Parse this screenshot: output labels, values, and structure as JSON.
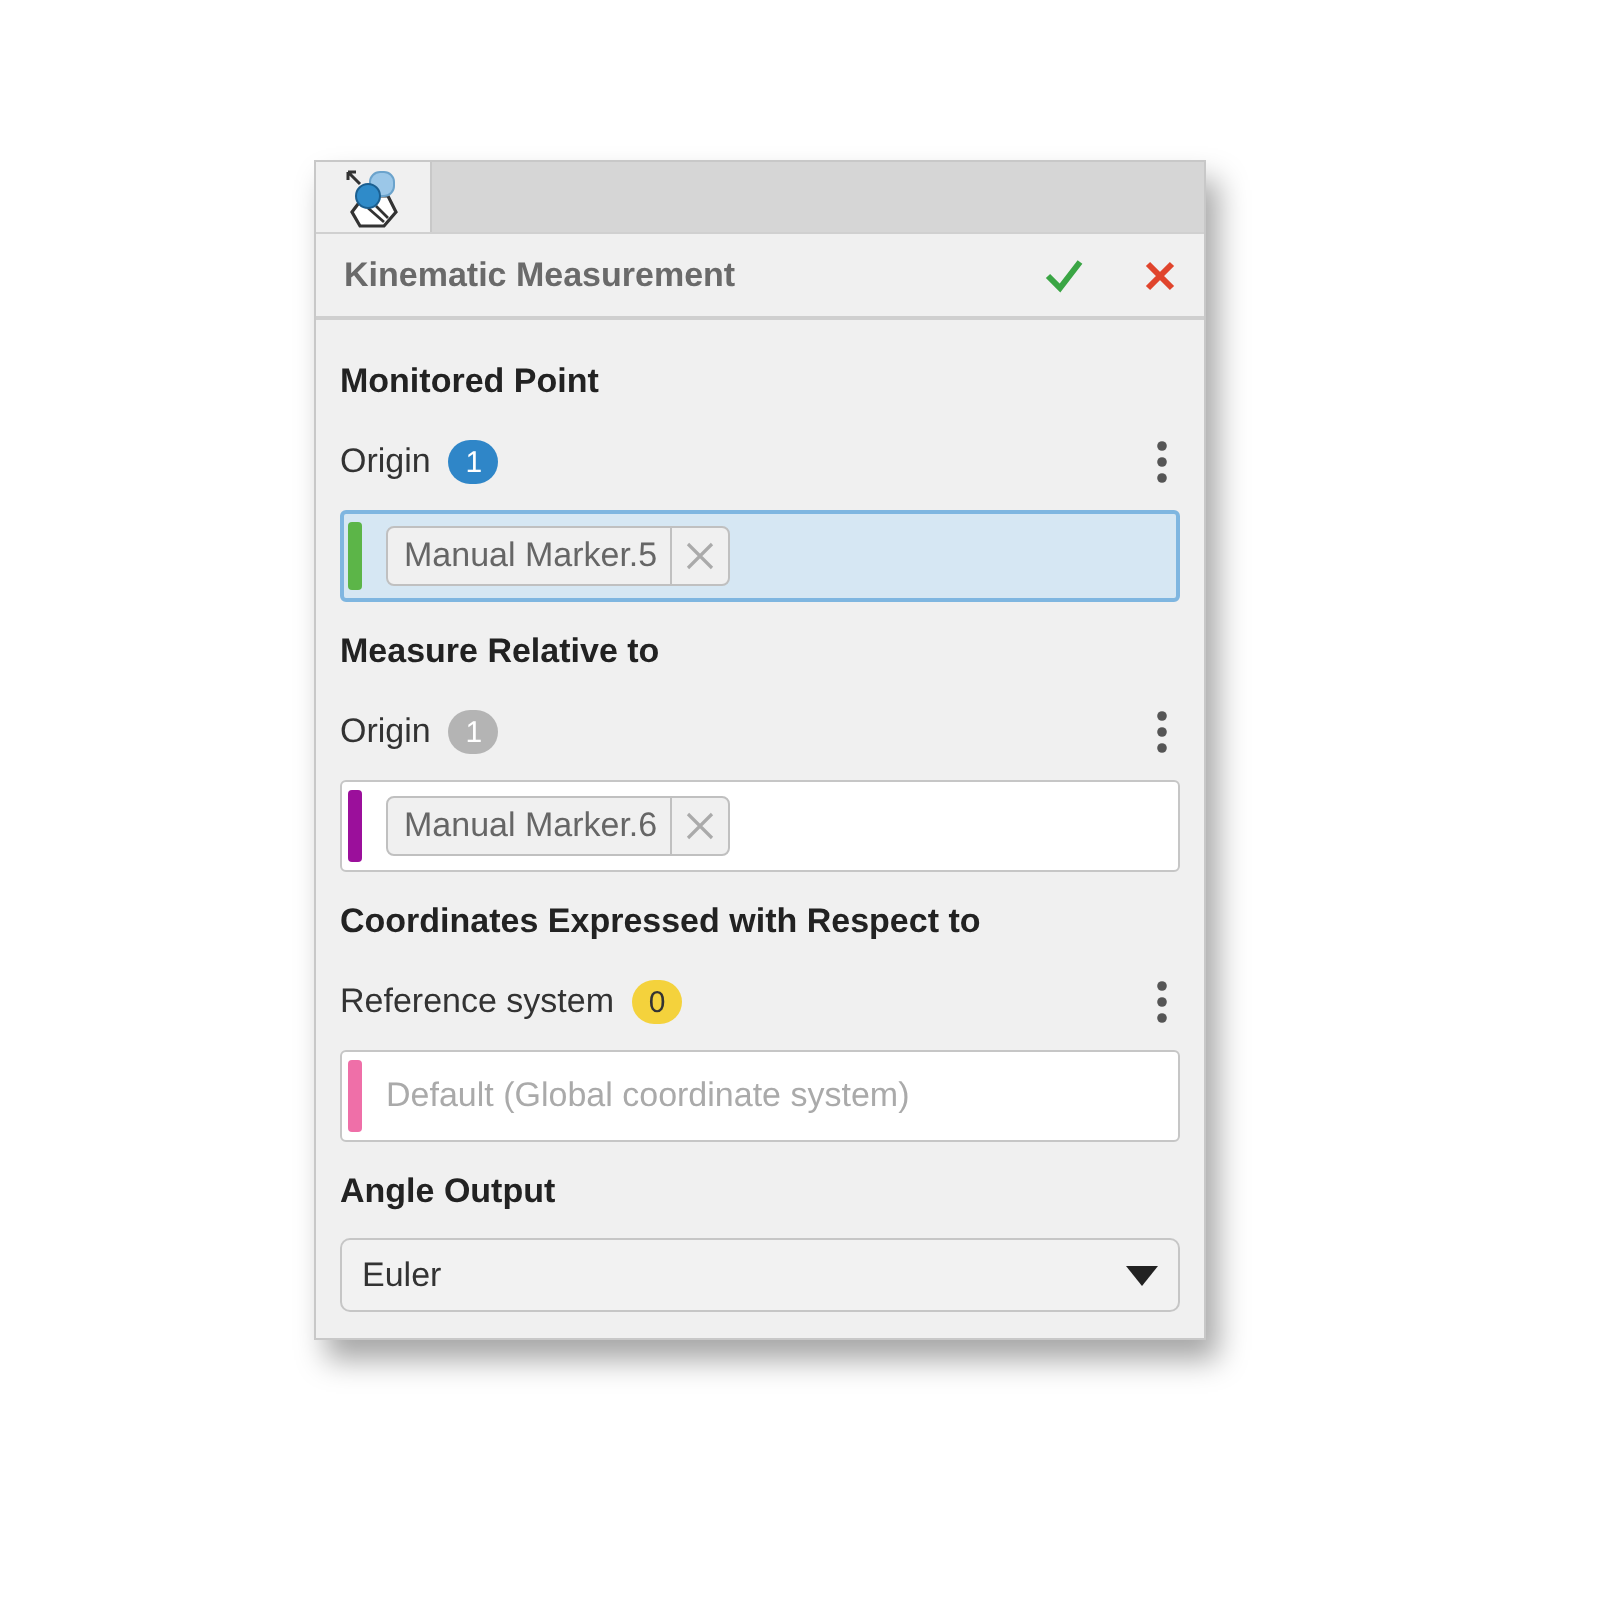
{
  "panel": {
    "title": "Kinematic Measurement"
  },
  "sections": [
    {
      "kind": "selector",
      "heading": "Monitored Point",
      "label": "Origin",
      "badge": {
        "count": "1",
        "color": "#2f86c8"
      },
      "stripe": {
        "color": "#5cb548"
      },
      "selected": true,
      "tags": [
        "Manual Marker.5"
      ]
    },
    {
      "kind": "selector",
      "heading": "Measure Relative to",
      "label": "Origin",
      "badge": {
        "count": "1",
        "color": "#b4b4b4"
      },
      "stripe": {
        "color": "#9b0f9b"
      },
      "selected": false,
      "tags": [
        "Manual Marker.6"
      ]
    },
    {
      "kind": "selector",
      "heading": "Coordinates Expressed with Respect to",
      "label": "Reference system",
      "badge": {
        "count": "0",
        "color": "#f4d23c"
      },
      "stripe": {
        "color": "#ef6fa8"
      },
      "selected": false,
      "placeholder": "Default (Global coordinate system)"
    },
    {
      "kind": "dropdown",
      "heading": "Angle Output",
      "value": "Euler"
    }
  ]
}
